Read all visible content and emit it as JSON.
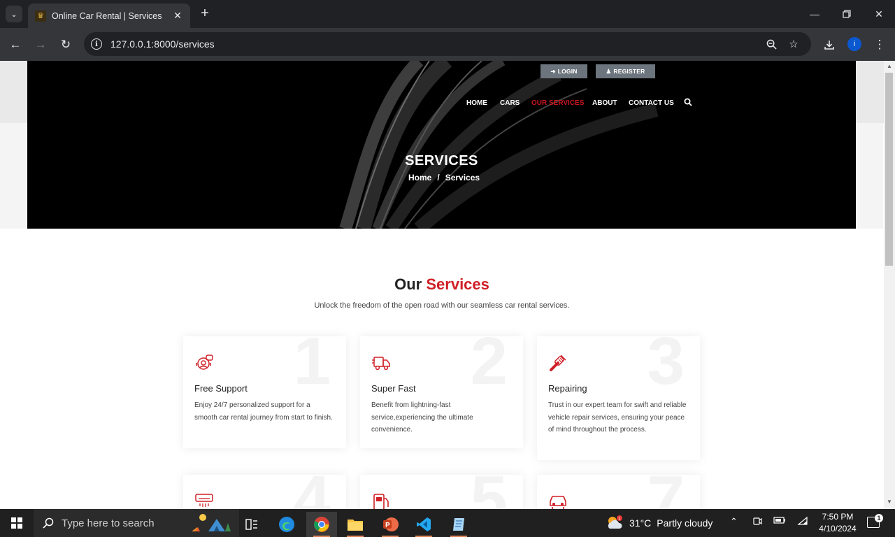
{
  "browser": {
    "tab_title": "Online Car Rental | Services",
    "url_host": "127.0.0.1",
    "url_path": ":8000/services"
  },
  "site": {
    "auth": {
      "login": "LOGIN",
      "register": "REGISTER"
    },
    "menu": [
      {
        "label": "HOME",
        "active": false
      },
      {
        "label": "CARS",
        "active": false
      },
      {
        "label": "OUR SERVICES",
        "active": true
      },
      {
        "label": "ABOUT",
        "active": false
      },
      {
        "label": "CONTACT US",
        "active": false
      }
    ],
    "hero": {
      "title": "SERVICES",
      "breadcrumb": {
        "home": "Home",
        "separator": "/",
        "current": "Services"
      }
    },
    "section": {
      "title_prefix": "Our",
      "title_highlight": "Services",
      "subtitle": "Unlock the freedom of the open road with our seamless car rental services."
    },
    "cards": [
      {
        "number": "1",
        "icon": "support-agent-icon",
        "title": "Free Support",
        "text": "Enjoy 24/7 personalized support for a smooth car rental journey from start to finish."
      },
      {
        "number": "2",
        "icon": "fast-delivery-truck-icon",
        "title": "Super Fast",
        "text": "Benefit from lightning-fast service,experiencing the ultimate convenience."
      },
      {
        "number": "3",
        "icon": "wrench-icon",
        "title": "Repairing",
        "text": "Trust in our expert team for swift and reliable vehicle repair services, ensuring your peace of mind throughout the process."
      },
      {
        "number": "4",
        "icon": "air-conditioner-icon",
        "title": "",
        "text": ""
      },
      {
        "number": "5",
        "icon": "fuel-pump-icon",
        "title": "",
        "text": ""
      },
      {
        "number": "7",
        "icon": "car-icon",
        "title": "",
        "text": ""
      }
    ],
    "accent_color": "#d01e26"
  },
  "taskbar": {
    "search_placeholder": "Type here to search",
    "weather": {
      "temp": "31°C",
      "condition": "Partly cloudy"
    },
    "time": "7:50 PM",
    "date": "4/10/2024",
    "notification_count": "1"
  }
}
